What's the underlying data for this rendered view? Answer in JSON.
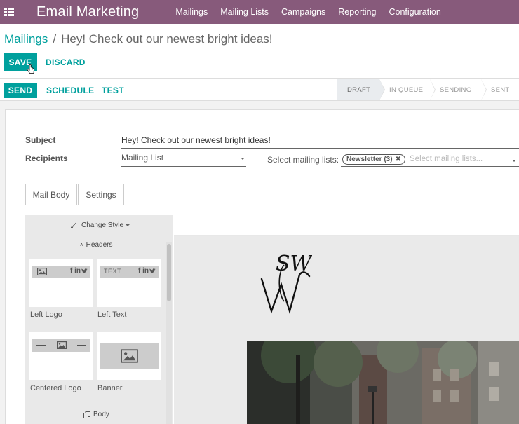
{
  "navbar": {
    "app_title": "Email Marketing",
    "menu": [
      "Mailings",
      "Mailing Lists",
      "Campaigns",
      "Reporting",
      "Configuration"
    ]
  },
  "breadcrumb": {
    "parent": "Mailings",
    "separator": "/",
    "current": "Hey! Check out our newest bright ideas!"
  },
  "buttons": {
    "save": "SAVE",
    "discard": "DISCARD",
    "send": "SEND",
    "schedule": "SCHEDULE",
    "test": "TEST"
  },
  "stages": [
    "DRAFT",
    "IN QUEUE",
    "SENDING",
    "SENT"
  ],
  "active_stage": "DRAFT",
  "form": {
    "subject_label": "Subject",
    "subject_value": "Hey! Check out our newest bright ideas!",
    "recipients_label": "Recipients",
    "recipients_value": "Mailing List",
    "select_lists_label": "Select mailing lists:",
    "selected_tag": "Newsletter (3)",
    "tag_close": "✖",
    "lists_placeholder": "Select mailing lists..."
  },
  "tabs": [
    "Mail Body",
    "Settings"
  ],
  "editor": {
    "change_style": "Change Style",
    "headers_section": "Headers",
    "body_section": "Body",
    "snippets": [
      {
        "caption": "Left Logo",
        "bar_text": "f in",
        "bird_icon": "twitter-icon"
      },
      {
        "caption": "Left Text",
        "bar_text": "TEXT",
        "social_text": "f in"
      },
      {
        "caption": "Centered Logo"
      },
      {
        "caption": "Banner"
      }
    ],
    "logo_text": "SW"
  },
  "colors": {
    "brand": "#875a7b",
    "accent": "#00a09d"
  }
}
